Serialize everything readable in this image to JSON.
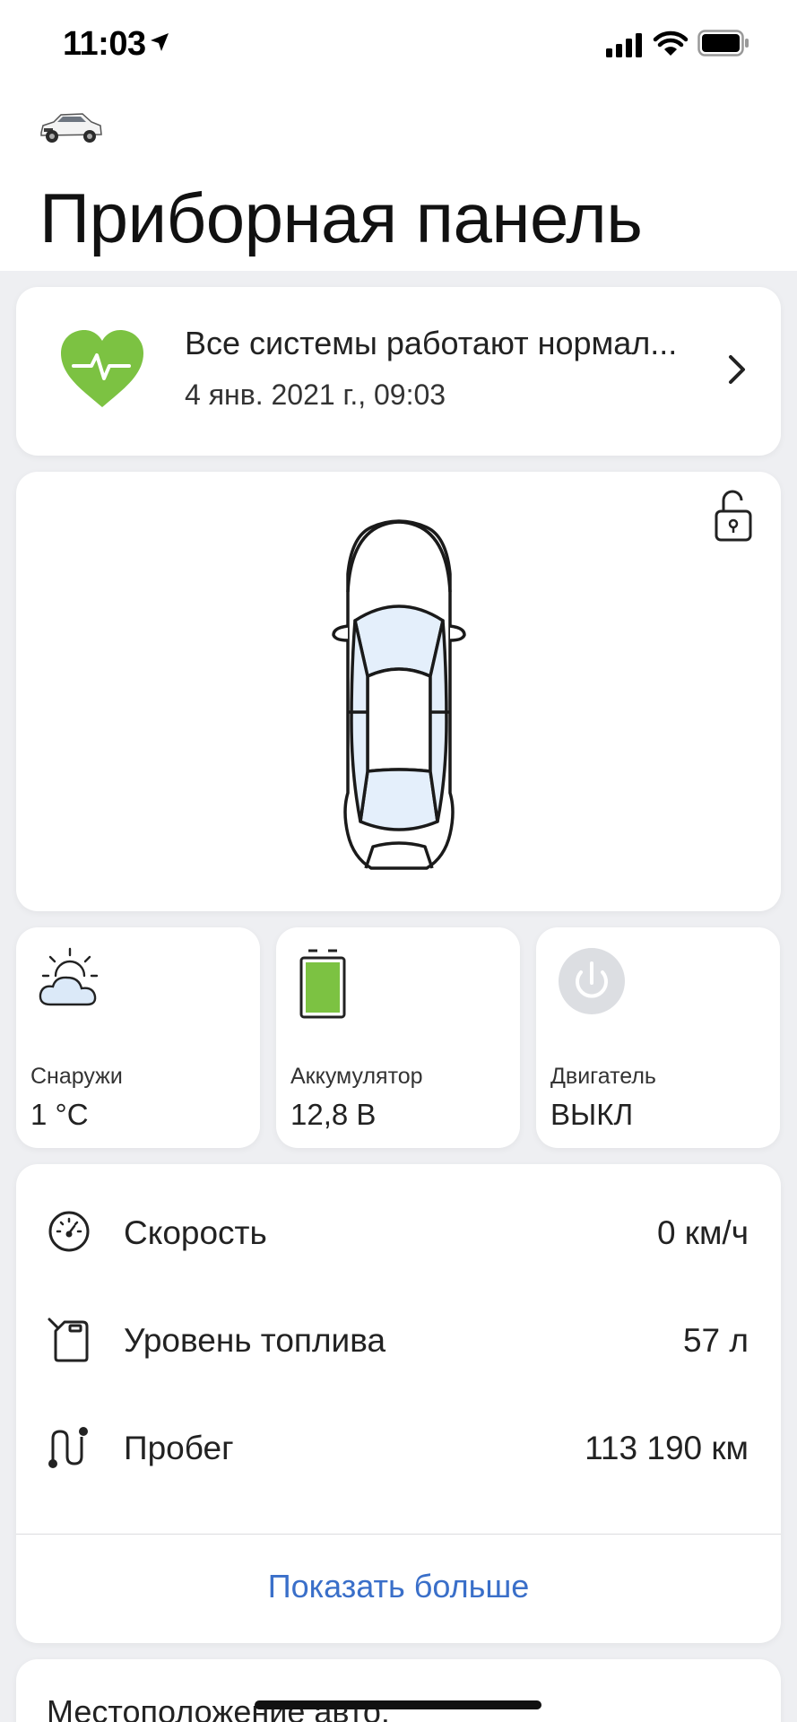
{
  "status_bar": {
    "time": "11:03",
    "icons": [
      "location-arrow-icon",
      "cellular-signal-icon",
      "wifi-icon",
      "battery-icon"
    ]
  },
  "header": {
    "vehicle_icon": "car-thumbnail-icon",
    "title": "Приборная панель"
  },
  "health": {
    "icon": "heart-pulse-icon",
    "title": "Все системы работают нормал...",
    "timestamp": "4 янв. 2021 г., 09:03",
    "status_color": "#7cc242"
  },
  "vehicle_view": {
    "lock_icon": "unlocked-padlock-icon"
  },
  "tiles": {
    "outside": {
      "icon": "partly-cloudy-icon",
      "label": "Снаружи",
      "value": "1 °C"
    },
    "battery": {
      "icon": "battery-full-icon",
      "label": "Аккумулятор",
      "value": "12,8 В",
      "level": 1.0
    },
    "engine": {
      "icon": "power-icon",
      "label": "Двигатель",
      "value": "ВЫКЛ"
    }
  },
  "stats": [
    {
      "icon": "speedometer-icon",
      "label": "Скорость",
      "value": "0 км/ч"
    },
    {
      "icon": "fuel-can-icon",
      "label": "Уровень топлива",
      "value": "57 л"
    },
    {
      "icon": "route-icon",
      "label": "Пробег",
      "value": "113 190 км"
    }
  ],
  "show_more_label": "Показать больше",
  "location": {
    "title": "Местоположение авто."
  },
  "colors": {
    "accent_link": "#3a6fc9",
    "battery_green": "#7cc242",
    "background": "#eeeff2"
  }
}
